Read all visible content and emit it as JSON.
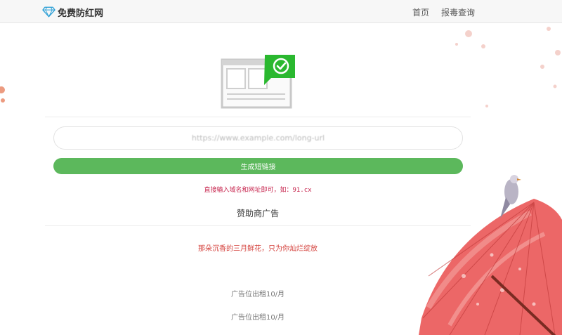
{
  "header": {
    "logo_text": "免费防红网",
    "nav": [
      "首页",
      "报毒查询"
    ]
  },
  "main": {
    "input_placeholder": "https://www.example.com/long-url",
    "generate_button": "生成短链接",
    "hint": "直接输入域名和网址即可，如：91.cx",
    "sponsor_title": "赞助商广告",
    "ads": [
      "那朵沉香的三月鲜花，只为你灿烂绽放",
      "广告位出租10/月",
      "广告位出租10/月"
    ]
  },
  "colors": {
    "accent_green": "#5cb85c",
    "check_green": "#2ab82f",
    "hint_red": "#c7254e",
    "ad_red": "#d43f3a"
  }
}
